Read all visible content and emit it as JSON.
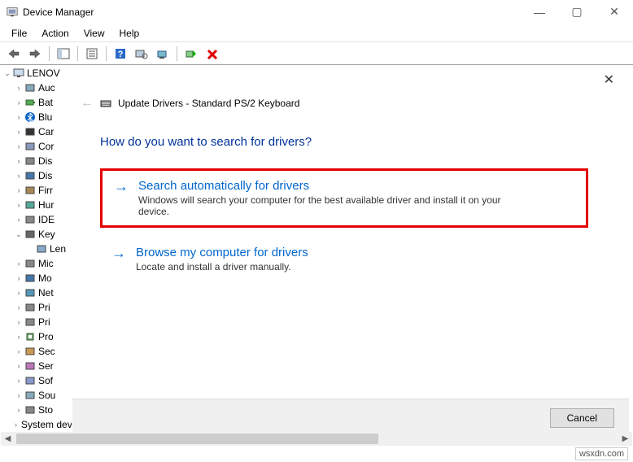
{
  "window": {
    "title": "Device Manager"
  },
  "win_controls": {
    "min": "—",
    "max": "▢",
    "close": "✕"
  },
  "menu": {
    "file": "File",
    "action": "Action",
    "view": "View",
    "help": "Help"
  },
  "tree": {
    "root": "LENOV",
    "items": [
      {
        "label": "Auc",
        "icon": "speaker"
      },
      {
        "label": "Bat",
        "icon": "battery"
      },
      {
        "label": "Blu",
        "icon": "bluetooth"
      },
      {
        "label": "Car",
        "icon": "camera"
      },
      {
        "label": "Cor",
        "icon": "computer"
      },
      {
        "label": "Dis",
        "icon": "disk"
      },
      {
        "label": "Dis",
        "icon": "display"
      },
      {
        "label": "Firr",
        "icon": "firmware"
      },
      {
        "label": "Hur",
        "icon": "hid"
      },
      {
        "label": "IDE",
        "icon": "ide"
      },
      {
        "label": "Key",
        "icon": "keyboard",
        "expanded": true,
        "children": [
          {
            "label": "Len",
            "icon": "keyboard-dev"
          }
        ]
      },
      {
        "label": "Mic",
        "icon": "mouse"
      },
      {
        "label": "Mo",
        "icon": "monitor"
      },
      {
        "label": "Net",
        "icon": "network"
      },
      {
        "label": "Pri",
        "icon": "print-queue"
      },
      {
        "label": "Pri",
        "icon": "printer"
      },
      {
        "label": "Pro",
        "icon": "cpu"
      },
      {
        "label": "Sec",
        "icon": "security"
      },
      {
        "label": "Ser",
        "icon": "sensor"
      },
      {
        "label": "Sof",
        "icon": "software"
      },
      {
        "label": "Sou",
        "icon": "sound"
      },
      {
        "label": "Sto",
        "icon": "storage"
      },
      {
        "label": "System devices",
        "icon": "system"
      }
    ]
  },
  "dialog": {
    "title": "Update Drivers - Standard PS/2 Keyboard",
    "question": "How do you want to search for drivers?",
    "opt1": {
      "title": "Search automatically for drivers",
      "desc": "Windows will search your computer for the best available driver and install it on your device."
    },
    "opt2": {
      "title": "Browse my computer for drivers",
      "desc": "Locate and install a driver manually."
    },
    "cancel": "Cancel"
  },
  "watermark": "wsxdn.com"
}
